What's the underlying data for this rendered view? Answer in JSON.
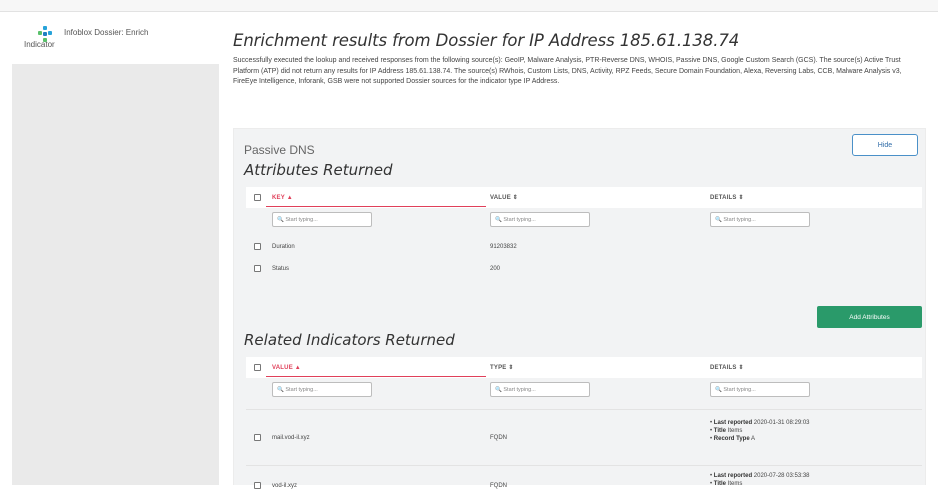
{
  "sidebar": {
    "title_line1": "Infoblox Dossier: Enrich",
    "title_line2": "Indicator",
    "logo_icon": "infoblox-logo-icon"
  },
  "main": {
    "title": "Enrichment results from Dossier for IP Address 185.61.138.74",
    "description": "Successfully executed the lookup and received responses from the following source(s): GeoIP, Malware Analysis, PTR-Reverse DNS, WHOIS, Passive DNS, Google Custom Search (GCS). The source(s) Active Trust Platform (ATP) did not return any results for IP Address 185.61.138.74. The source(s) RWhois, Custom Lists, DNS, Activity, RPZ Feeds, Secure Domain Foundation, Alexa, Reversing Labs, CCB, Malware Analysis v3, FireEye Intelligence, Inforank, GSB were not supported Dossier sources for the indicator type IP Address."
  },
  "panel": {
    "label": "Passive DNS",
    "hide_label": "Hide",
    "attributes": {
      "title": "Attributes Returned",
      "columns": [
        "KEY ▲",
        "VALUE ⇕",
        "DETAILS ⇕"
      ],
      "filter_placeholder": "🔍 Start typing...",
      "rows": [
        {
          "key": "Duration",
          "value": "91203832"
        },
        {
          "key": "Status",
          "value": "200"
        }
      ],
      "add_label": "Add Attributes"
    },
    "related": {
      "title": "Related Indicators Returned",
      "columns": [
        "VALUE ▲",
        "TYPE ⇕",
        "DETAILS ⇕"
      ],
      "filter_placeholder": "🔍 Start typing...",
      "rows": [
        {
          "value": "mail.vod-il.xyz",
          "type": "FQDN",
          "details": [
            {
              "k": "Last reported",
              "v": "2020-01-31 08:29:03"
            },
            {
              "k": "Title",
              "v": "Items"
            },
            {
              "k": "Record Type",
              "v": "A"
            }
          ]
        },
        {
          "value": "vod-il.xyz",
          "type": "FQDN",
          "details": [
            {
              "k": "Last reported",
              "v": "2020-07-28 03:53:38"
            },
            {
              "k": "Title",
              "v": "Items"
            }
          ]
        }
      ]
    }
  },
  "colors": {
    "accent_sort": "#e0405a",
    "primary_button": "#2a9a6a",
    "outline_button": "#4a90c8"
  }
}
